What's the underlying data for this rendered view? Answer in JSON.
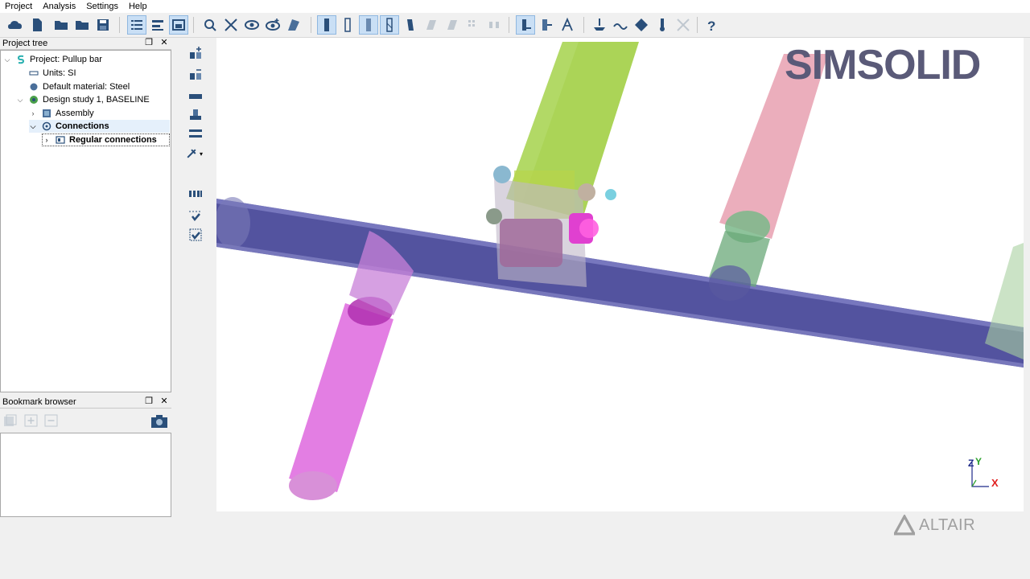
{
  "menu": [
    "Project",
    "Analysis",
    "Settings",
    "Help"
  ],
  "toolbar": {
    "buttons": [
      "cloud-icon",
      "new-project-icon",
      "open-folder-icon",
      "open-recent-icon",
      "save-icon",
      "project-tree-toggle-icon",
      "bookmark-toggle-icon",
      "view-toggle-icon",
      "zoom-fit-icon",
      "auto-connect-icon",
      "hide-show-icon",
      "show-all-icon",
      "section-view-icon",
      "shaded-view-icon",
      "wireframe-view-icon",
      "transparent-view-icon",
      "edges-view-icon",
      "part-view-icon",
      "mesh-view-icon",
      "grid-view-icon",
      "stress-view-icon",
      "connection-view-icon",
      "load-view-icon",
      "annotation-icon",
      "fixed-support-icon",
      "force-load-icon",
      "pressure-load-icon",
      "thermal-load-icon",
      "remove-load-icon",
      "help-icon"
    ]
  },
  "project_tree": {
    "title": "Project tree",
    "items": [
      {
        "label": "Project: Pullup bar",
        "icon": "simsolid-logo-icon"
      },
      {
        "label": "Units: SI",
        "icon": "ruler-icon"
      },
      {
        "label": "Default material: Steel",
        "icon": "material-icon"
      },
      {
        "label": "Design study 1, BASELINE",
        "icon": "design-study-icon"
      },
      {
        "label": "Assembly",
        "icon": "assembly-icon"
      },
      {
        "label": "Connections",
        "icon": "connections-icon"
      },
      {
        "label": "Regular connections",
        "icon": "regular-connections-icon"
      }
    ]
  },
  "bookmark_browser": {
    "title": "Bookmark browser"
  },
  "viewport": {
    "logo_text": "SIMSOLID",
    "brand_text": "ALTAIR",
    "axis_labels": {
      "z": "Z",
      "y": "Y",
      "x": "X"
    }
  },
  "colors": {
    "main_tube": "#4a4a9a",
    "pink_tube": "#e070e0",
    "green_arm": "#9ccc3a",
    "light_pink_tube": "#e8a0b0",
    "bracket": "#a08aa0",
    "logo": "#5a5a78",
    "logo_accent": "#7a3d4a"
  }
}
